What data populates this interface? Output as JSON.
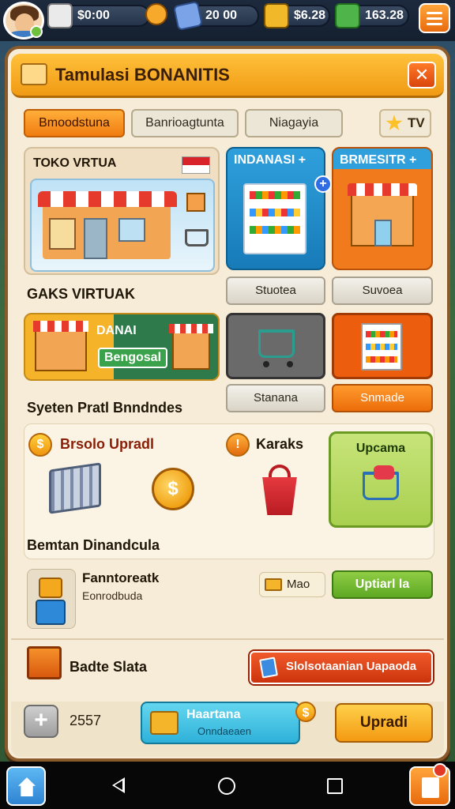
{
  "topbar": {
    "resources": [
      {
        "icon": "clipboard-icon",
        "value": "$0:00"
      },
      {
        "icon": "cash-icon",
        "value": "20 00"
      },
      {
        "icon": "gold-crate-icon",
        "value": "$6.28"
      },
      {
        "icon": "green-cash-icon",
        "value": "163.28"
      }
    ]
  },
  "panel": {
    "title": "Tamulasi BONANITIS",
    "tabs": [
      {
        "label": "Bmoodstuna",
        "active": true
      },
      {
        "label": "Banrioagtunta",
        "active": false
      },
      {
        "label": "Niagayia",
        "active": false
      }
    ],
    "tv_label": "TV"
  },
  "cards": {
    "shop_label": "TOKO VRTUA",
    "blue_card_title": "INDANASI +",
    "orange_card_title": "BRMESITR +",
    "section1_label": "GAKS VIRTUAK",
    "btn_blue": "Stuotea",
    "btn_orange_card": "Suvoea",
    "combo_top": "DANAI",
    "combo_tag": "Bengosal",
    "section2_label": "Syeten Pratl Bnndndes",
    "btn_dark": "Stanana",
    "btn_orange": "Snmade"
  },
  "lower": {
    "upgrade_label": "Brsolo Upradl",
    "karaks_label": "Karaks",
    "upcama_label": "Upcama",
    "section3_label": "Bemtan Dinandcula"
  },
  "task": {
    "title": "Fanntoreatk",
    "subtitle": "Eonrodbuda",
    "chip": "Mao",
    "button": "Uptiarl la"
  },
  "bonus": {
    "label": "Badte Slata",
    "button": "Slolsotaanian Uapaoda"
  },
  "footer": {
    "count": "2557",
    "teal_title": "Haartana",
    "teal_sub": "Onndaeaen",
    "coin": "$",
    "yellow_btn": "Upradi"
  }
}
